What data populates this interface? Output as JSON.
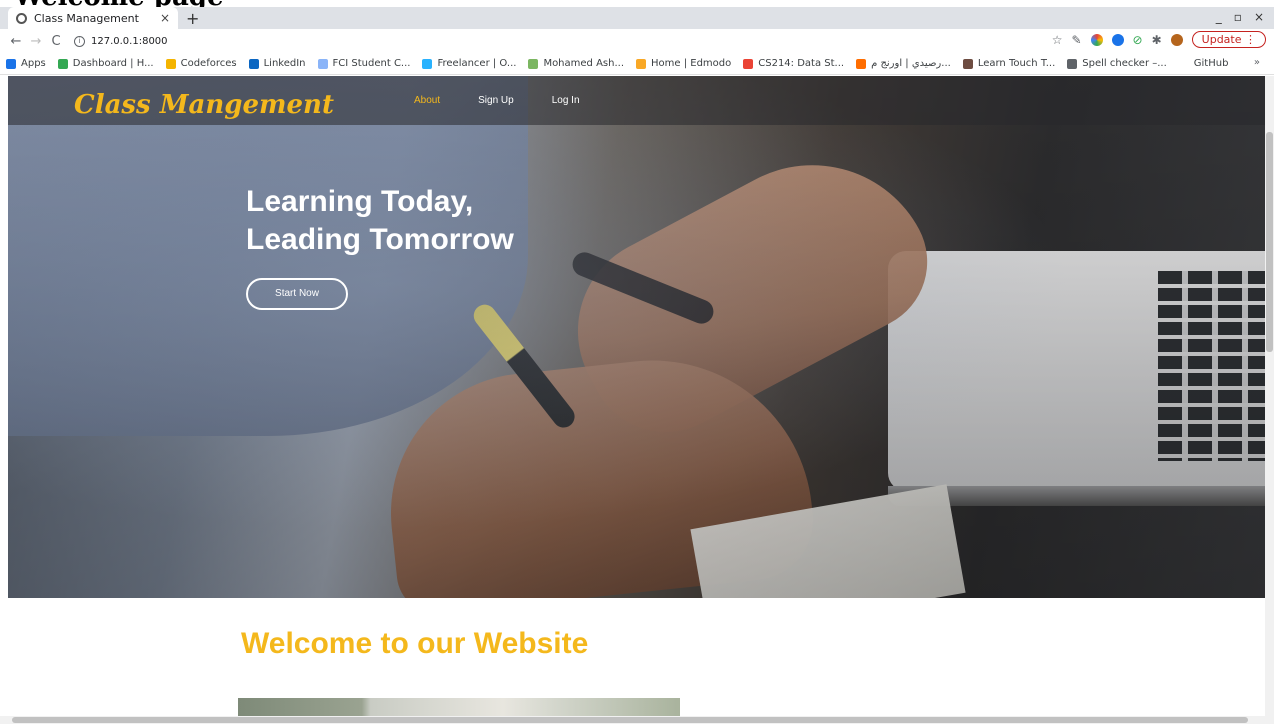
{
  "document": {
    "caption": "Welcome page"
  },
  "browser": {
    "tab": {
      "title": "Class Management",
      "close_glyph": "×"
    },
    "new_tab_glyph": "+",
    "window_controls": [
      "_",
      "▫",
      "×"
    ],
    "nav": {
      "back": "←",
      "forward": "→",
      "reload": "C"
    },
    "address": {
      "url": "127.0.0.1:8000",
      "info_icon": "info-icon"
    },
    "toolbar_icons": [
      "star-icon",
      "pen-icon",
      "color-wheel-icon",
      "shield-icon",
      "check-icon",
      "puzzle-icon",
      "profile-avatar-icon"
    ],
    "update_label": "Update",
    "update_menu_glyph": "⋮",
    "bookmarks": [
      {
        "label": "Apps",
        "color": "#1a73e8"
      },
      {
        "label": "Dashboard | H...",
        "color": "#34a853"
      },
      {
        "label": "Codeforces",
        "color": "#f4b400"
      },
      {
        "label": "LinkedIn",
        "color": "#0a66c2"
      },
      {
        "label": "FCI Student C...",
        "color": "#8ab4f8"
      },
      {
        "label": "Freelancer | O...",
        "color": "#29b2fe"
      },
      {
        "label": "Mohamed Ash...",
        "color": "#7bb661"
      },
      {
        "label": "Home | Edmodo",
        "color": "#f9a825"
      },
      {
        "label": "CS214: Data St...",
        "color": "#ea4335"
      },
      {
        "label": "رصيدي | اورنج م...",
        "color": "#ff6d00"
      },
      {
        "label": "Learn Touch T...",
        "color": "#6d4c41"
      },
      {
        "label": "Spell checker –...",
        "color": "#5f6368"
      },
      {
        "label": "GitHub",
        "color": "#ffffff"
      }
    ],
    "bookmarks_more": "»"
  },
  "site": {
    "logo": "Class Mangement",
    "nav": [
      {
        "label": "About",
        "active": true
      },
      {
        "label": "Sign Up",
        "active": false
      },
      {
        "label": "Log In",
        "active": false
      }
    ],
    "hero": {
      "title_line1": "Learning Today,",
      "title_line2": "Leading Tomorrow",
      "cta": "Start Now"
    },
    "welcome_heading": "Welcome to our Website"
  },
  "colors": {
    "accent": "#f4b81c",
    "text_light": "#ffffff",
    "update_red": "#c5221f"
  }
}
